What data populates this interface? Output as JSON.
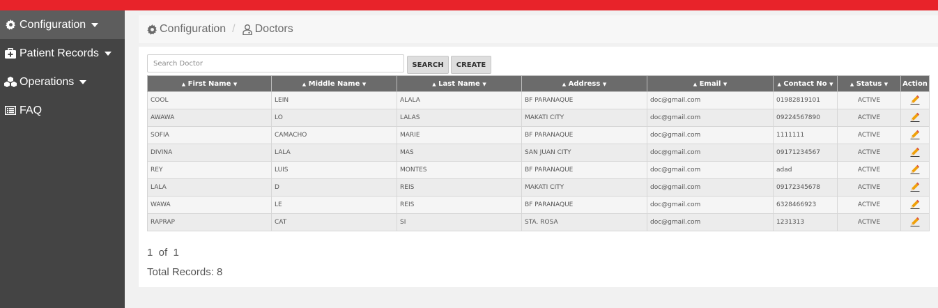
{
  "sidebar": {
    "items": [
      {
        "label": "Configuration",
        "icon": "gear-icon",
        "active": true,
        "has_caret": true
      },
      {
        "label": "Patient Records",
        "icon": "medkit-icon",
        "active": false,
        "has_caret": true
      },
      {
        "label": "Operations",
        "icon": "cubes-icon",
        "active": false,
        "has_caret": true
      },
      {
        "label": "FAQ",
        "icon": "list-icon",
        "active": false,
        "has_caret": false
      }
    ]
  },
  "breadcrumb": {
    "root": "Configuration",
    "current": "Doctors"
  },
  "search": {
    "placeholder": "Search Doctor",
    "value": "",
    "search_label": "SEARCH",
    "create_label": "CREATE"
  },
  "table": {
    "columns": [
      "First Name",
      "Middle Name",
      "Last Name",
      "Address",
      "Email",
      "Contact No",
      "Status"
    ],
    "action_header": "Action",
    "rows": [
      [
        "COOL",
        "LEIN",
        "ALALA",
        "BF PARANAQUE",
        "doc@gmail.com",
        "01982819101",
        "ACTIVE"
      ],
      [
        "AWAWA",
        "LO",
        "LALAS",
        "MAKATI CITY",
        "doc@gmail.com",
        "09224567890",
        "ACTIVE"
      ],
      [
        "SOFIA",
        "CAMACHO",
        "MARIE",
        "BF PARANAQUE",
        "doc@gmail.com",
        "1111111",
        "ACTIVE"
      ],
      [
        "DIVINA",
        "LALA",
        "MAS",
        "SAN JUAN CITY",
        "doc@gmail.com",
        "09171234567",
        "ACTIVE"
      ],
      [
        "REY",
        "LUIS",
        "MONTES",
        "BF PARANAQUE",
        "doc@gmail.com",
        "adad",
        "ACTIVE"
      ],
      [
        "LALA",
        "D",
        "REIS",
        "MAKATI CITY",
        "doc@gmail.com",
        "09172345678",
        "ACTIVE"
      ],
      [
        "WAWA",
        "LE",
        "REIS",
        "BF PARANAQUE",
        "doc@gmail.com",
        "6328466923",
        "ACTIVE"
      ],
      [
        "RAPRAP",
        "CAT",
        "SI",
        "STA. ROSA",
        "doc@gmail.com",
        "1231313",
        "ACTIVE"
      ]
    ]
  },
  "pagination": {
    "text": "1  of  1",
    "total": "Total Records: 8"
  },
  "colors": {
    "topbar": "#e8232a",
    "sidebar": "#444444",
    "table_header": "#6b6b6b",
    "edit_icon": "#f0a10a"
  }
}
